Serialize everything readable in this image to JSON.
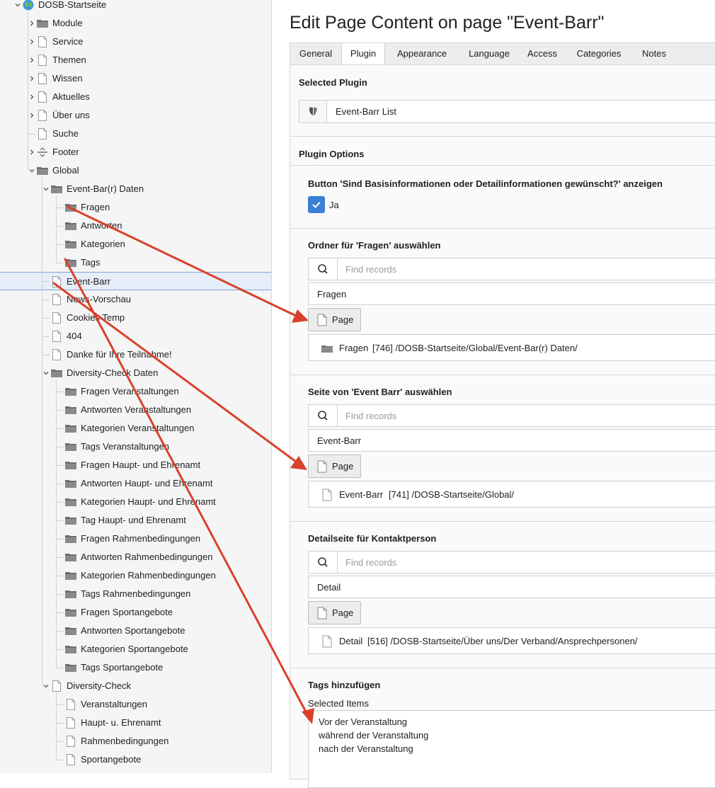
{
  "tree": {
    "items": [
      {
        "label": "DOSB-Startseite",
        "icon": "globe-icon",
        "level": 0,
        "toggle": "expanded",
        "name": "tree-item-dosb-startseite"
      },
      {
        "label": "Module",
        "icon": "folder-icon",
        "level": 1,
        "toggle": "collapsed",
        "name": "tree-item-module"
      },
      {
        "label": "Service",
        "icon": "page-icon",
        "level": 1,
        "toggle": "collapsed",
        "name": "tree-item-service"
      },
      {
        "label": "Themen",
        "icon": "page-icon",
        "level": 1,
        "toggle": "collapsed",
        "name": "tree-item-themen"
      },
      {
        "label": "Wissen",
        "icon": "page-icon",
        "level": 1,
        "toggle": "collapsed",
        "name": "tree-item-wissen"
      },
      {
        "label": "Aktuelles",
        "icon": "page-icon",
        "level": 1,
        "toggle": "collapsed",
        "name": "tree-item-aktuelles"
      },
      {
        "label": "Über uns",
        "icon": "page-icon",
        "level": 1,
        "toggle": "collapsed",
        "name": "tree-item-ueber-uns"
      },
      {
        "label": "Suche",
        "icon": "page-icon",
        "level": 1,
        "toggle": "none",
        "name": "tree-item-suche"
      },
      {
        "label": "Footer",
        "icon": "separator-icon",
        "level": 1,
        "toggle": "collapsed",
        "name": "tree-item-footer"
      },
      {
        "label": "Global",
        "icon": "folder-icon",
        "level": 1,
        "toggle": "expanded",
        "name": "tree-item-global"
      },
      {
        "label": "Event-Bar(r) Daten",
        "icon": "folder-icon",
        "level": 2,
        "toggle": "expanded",
        "name": "tree-item-event-barr-daten"
      },
      {
        "label": "Fragen",
        "icon": "folder-icon",
        "level": 3,
        "toggle": "none",
        "name": "tree-item-fragen"
      },
      {
        "label": "Antworten",
        "icon": "folder-icon",
        "level": 3,
        "toggle": "none",
        "name": "tree-item-antworten"
      },
      {
        "label": "Kategorien",
        "icon": "folder-icon",
        "level": 3,
        "toggle": "none",
        "name": "tree-item-kategorien"
      },
      {
        "label": "Tags",
        "icon": "folder-icon",
        "level": 3,
        "toggle": "none",
        "name": "tree-item-tags"
      },
      {
        "label": "Event-Barr",
        "icon": "page-icon",
        "level": 2,
        "toggle": "none",
        "selected": true,
        "name": "tree-item-event-barr"
      },
      {
        "label": "News-Vorschau",
        "icon": "page-icon",
        "level": 2,
        "toggle": "none",
        "name": "tree-item-news-vorschau"
      },
      {
        "label": "Cookies Temp",
        "icon": "page-icon",
        "level": 2,
        "toggle": "none",
        "name": "tree-item-cookies-temp"
      },
      {
        "label": "404",
        "icon": "page-icon",
        "level": 2,
        "toggle": "none",
        "name": "tree-item-404"
      },
      {
        "label": "Danke für Ihre Teilnahme!",
        "icon": "page-icon",
        "level": 2,
        "toggle": "none",
        "name": "tree-item-danke"
      },
      {
        "label": "Diversity-Check Daten",
        "icon": "folder-icon",
        "level": 2,
        "toggle": "expanded",
        "name": "tree-item-diversity-check-daten"
      },
      {
        "label": "Fragen Veranstaltungen",
        "icon": "folder-icon",
        "level": 3,
        "toggle": "none",
        "name": "tree-item-fragen-veranstaltungen"
      },
      {
        "label": "Antworten Veranstaltungen",
        "icon": "folder-icon",
        "level": 3,
        "toggle": "none",
        "name": "tree-item-antworten-veranstaltungen"
      },
      {
        "label": "Kategorien Veranstaltungen",
        "icon": "folder-icon",
        "level": 3,
        "toggle": "none",
        "name": "tree-item-kategorien-veranstaltungen"
      },
      {
        "label": "Tags Veranstaltungen",
        "icon": "folder-icon",
        "level": 3,
        "toggle": "none",
        "name": "tree-item-tags-veranstaltungen"
      },
      {
        "label": "Fragen Haupt- und Ehrenamt",
        "icon": "folder-icon",
        "level": 3,
        "toggle": "none",
        "name": "tree-item-fragen-haupt-ehrenamt"
      },
      {
        "label": "Antworten Haupt- und Ehrenamt",
        "icon": "folder-icon",
        "level": 3,
        "toggle": "none",
        "name": "tree-item-antworten-haupt-ehrenamt"
      },
      {
        "label": "Kategorien Haupt- und Ehrenamt",
        "icon": "folder-icon",
        "level": 3,
        "toggle": "none",
        "name": "tree-item-kategorien-haupt-ehrenamt"
      },
      {
        "label": "Tag Haupt- und Ehrenamt",
        "icon": "folder-icon",
        "level": 3,
        "toggle": "none",
        "name": "tree-item-tag-haupt-ehrenamt"
      },
      {
        "label": "Fragen Rahmenbedingungen",
        "icon": "folder-icon",
        "level": 3,
        "toggle": "none",
        "name": "tree-item-fragen-rahmenbedingungen"
      },
      {
        "label": "Antworten Rahmenbedingungen",
        "icon": "folder-icon",
        "level": 3,
        "toggle": "none",
        "name": "tree-item-antworten-rahmenbedingungen"
      },
      {
        "label": "Kategorien Rahmenbedingungen",
        "icon": "folder-icon",
        "level": 3,
        "toggle": "none",
        "name": "tree-item-kategorien-rahmenbedingungen"
      },
      {
        "label": "Tags Rahmenbedingungen",
        "icon": "folder-icon",
        "level": 3,
        "toggle": "none",
        "name": "tree-item-tags-rahmenbedingungen"
      },
      {
        "label": "Fragen Sportangebote",
        "icon": "folder-icon",
        "level": 3,
        "toggle": "none",
        "name": "tree-item-fragen-sportangebote"
      },
      {
        "label": "Antworten Sportangebote",
        "icon": "folder-icon",
        "level": 3,
        "toggle": "none",
        "name": "tree-item-antworten-sportangebote"
      },
      {
        "label": "Kategorien Sportangebote",
        "icon": "folder-icon",
        "level": 3,
        "toggle": "none",
        "name": "tree-item-kategorien-sportangebote"
      },
      {
        "label": "Tags Sportangebote",
        "icon": "folder-icon",
        "level": 3,
        "toggle": "none",
        "name": "tree-item-tags-sportangebote"
      },
      {
        "label": "Diversity-Check",
        "icon": "page-icon",
        "level": 2,
        "toggle": "expanded",
        "name": "tree-item-diversity-check"
      },
      {
        "label": "Veranstaltungen",
        "icon": "page-icon",
        "level": 3,
        "toggle": "none",
        "name": "tree-item-veranstaltungen"
      },
      {
        "label": "Haupt- u. Ehrenamt",
        "icon": "page-icon",
        "level": 3,
        "toggle": "none",
        "name": "tree-item-haupt-u-ehrenamt"
      },
      {
        "label": "Rahmenbedingungen",
        "icon": "page-icon",
        "level": 3,
        "toggle": "none",
        "name": "tree-item-rahmenbedingungen"
      },
      {
        "label": "Sportangebote",
        "icon": "page-icon",
        "level": 3,
        "toggle": "none",
        "name": "tree-item-sportangebote"
      }
    ]
  },
  "main": {
    "title": "Edit Page Content on page \"Event-Barr\"",
    "tabs": [
      {
        "label": "General",
        "active": false
      },
      {
        "label": "Plugin",
        "active": true
      },
      {
        "label": "Appearance",
        "active": false
      },
      {
        "label": "Language",
        "active": false
      },
      {
        "label": "Access",
        "active": false
      },
      {
        "label": "Categories",
        "active": false
      },
      {
        "label": "Notes",
        "active": false
      }
    ],
    "selected_plugin": {
      "section_title": "Selected Plugin",
      "value": "Event-Barr List",
      "icon": "typo3-logo-icon"
    },
    "plugin_options": {
      "section_title": "Plugin Options",
      "toggle": {
        "label": "Button 'Sind Basisinformationen oder Detailinformationen gewünscht?' anzeigen",
        "checkbox_label": "Ja",
        "checked": true
      },
      "fragen": {
        "label": "Ordner für 'Fragen' auswählen",
        "search_placeholder": "Find records",
        "value": "Fragen",
        "button": "Page",
        "record_title": "Fragen",
        "record_path": "[746] /DOSB-Startseite/Global/Event-Bar(r) Daten/",
        "record_icon": "folder-icon"
      },
      "event_barr": {
        "label": "Seite von 'Event Barr' auswählen",
        "search_placeholder": "Find records",
        "value": "Event-Barr",
        "button": "Page",
        "record_title": "Event-Barr",
        "record_path": "[741] /DOSB-Startseite/Global/",
        "record_icon": "page-icon"
      },
      "detail": {
        "label": "Detailseite für Kontaktperson",
        "search_placeholder": "Find records",
        "value": "Detail",
        "button": "Page",
        "record_title": "Detail",
        "record_path": "[516] /DOSB-Startseite/Über uns/Der Verband/Ansprechpersonen/",
        "record_icon": "page-icon"
      },
      "tags": {
        "label": "Tags hinzufügen",
        "selected_items_label": "Selected Items",
        "items": [
          "Vor der Veranstaltung",
          "während der Veranstaltung",
          "nach der Veranstaltung"
        ]
      }
    }
  },
  "colors": {
    "arrow": "#d9412c",
    "checkbox": "#3a7fd5",
    "selection": "#e6eef9",
    "tree_bg": "#f5f5f5"
  }
}
